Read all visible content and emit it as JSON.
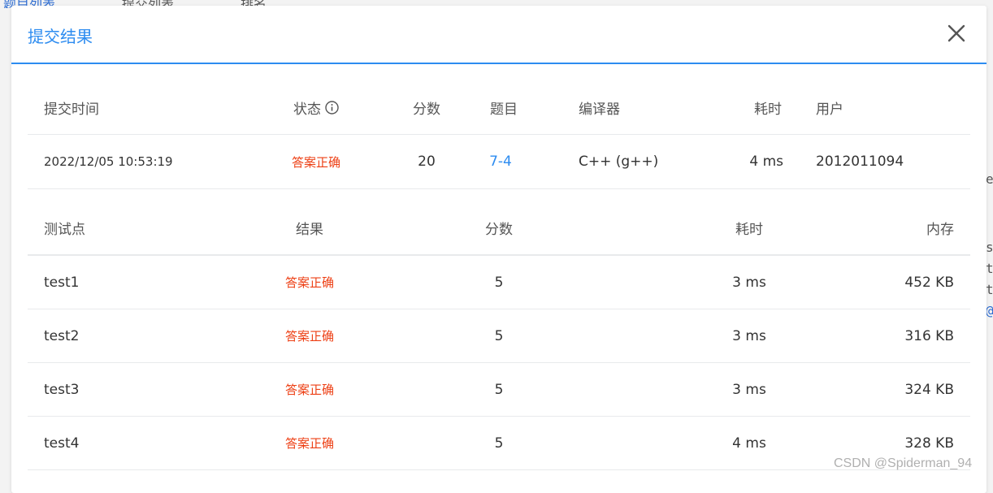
{
  "background": {
    "tabs": [
      "题目列表",
      "提交列表",
      "排名"
    ],
    "right_glyphs": [
      "e",
      "s",
      "t",
      "t",
      "@"
    ]
  },
  "modal": {
    "title": "提交结果",
    "close_icon": "close-icon"
  },
  "submission": {
    "headers": {
      "time": "提交时间",
      "status": "状态",
      "score": "分数",
      "problem": "题目",
      "compiler": "编译器",
      "elapsed": "耗时",
      "user": "用户"
    },
    "row": {
      "time": "2022/12/05 10:53:19",
      "status": "答案正确",
      "score": "20",
      "problem": "7-4",
      "compiler": "C++ (g++)",
      "elapsed": "4 ms",
      "user": "2012011094"
    }
  },
  "testcases": {
    "headers": {
      "point": "测试点",
      "result": "结果",
      "score": "分数",
      "elapsed": "耗时",
      "memory": "内存"
    },
    "rows": [
      {
        "point": "test1",
        "result": "答案正确",
        "score": "5",
        "elapsed": "3 ms",
        "memory": "452 KB"
      },
      {
        "point": "test2",
        "result": "答案正确",
        "score": "5",
        "elapsed": "3 ms",
        "memory": "316 KB"
      },
      {
        "point": "test3",
        "result": "答案正确",
        "score": "5",
        "elapsed": "3 ms",
        "memory": "324 KB"
      },
      {
        "point": "test4",
        "result": "答案正确",
        "score": "5",
        "elapsed": "4 ms",
        "memory": "328 KB"
      }
    ]
  },
  "watermark": "CSDN @Spiderman_94",
  "colors": {
    "accent": "#2d8cf0",
    "accepted": "#ed3f14"
  }
}
